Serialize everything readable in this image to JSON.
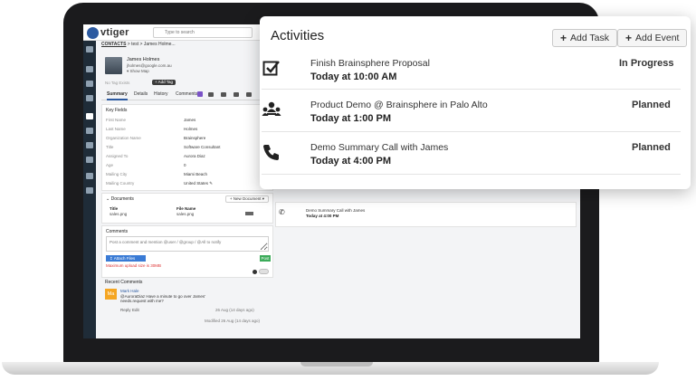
{
  "crm": {
    "logo_text": "vtiger",
    "search_placeholder": "Type to search",
    "breadcrumb": {
      "module": "CONTACTS",
      "rest": " > test > James Holme..."
    },
    "profile": {
      "name": "James Holmes",
      "email": "jholmes@google.com.au",
      "map": "▾ Show Map",
      "tags_empty": "No Tag Exists",
      "add_tag": "+ Add Tag"
    },
    "tabs": {
      "summary": "Summary",
      "details": "Details",
      "history": "History",
      "comments": "Comments"
    },
    "key_fields": {
      "title": "Key Fields",
      "rows": [
        {
          "label": "First Name",
          "value": "James"
        },
        {
          "label": "Last Name",
          "value": "Holmes"
        },
        {
          "label": "Organization Name",
          "value": "Brainsphere"
        },
        {
          "label": "Title",
          "value": "Software Consultant"
        },
        {
          "label": "Assigned To",
          "value": "Aurora Diaz"
        },
        {
          "label": "Age",
          "value": "0"
        },
        {
          "label": "Mailing City",
          "value": "Miami Beach"
        },
        {
          "label": "Mailing Country",
          "value": "United States ✎"
        }
      ]
    },
    "documents": {
      "title": "⌄ Documents",
      "new_button": "+ New Document ▾",
      "col_title": "Title",
      "col_file": "File Name",
      "row_title": "sales.png",
      "row_file": "sales.png"
    },
    "comments": {
      "title": "Comments",
      "placeholder": "Post a comment and mention @user / @group / @All to notify",
      "attach": "↥ Attach Files",
      "post": "Post",
      "note": "Maximum upload size is 30MB"
    },
    "recent_comments": {
      "title": "Recent Comments",
      "avatar": "Ma",
      "author": "Mark Hale",
      "text_1": "@AuroraDiaz Have a minute to go over James'",
      "text_2": "needs.request with me?",
      "date": "26 Aug (14 days ago)",
      "reply": "Reply",
      "edit": "Edit",
      "modified": "Modified 26 Aug (14 days ago)"
    },
    "background_activity": {
      "title": "Demo Summary Call with James",
      "time": "Today at 4:00 PM"
    }
  },
  "popup": {
    "title": "Activities",
    "add_task": "Add Task",
    "add_event": "Add Event",
    "activities": [
      {
        "icon": "checkbox-icon",
        "title": "Finish Brainsphere Proposal",
        "time": "Today at 10:00 AM",
        "status": "In Progress"
      },
      {
        "icon": "group-meeting-icon",
        "title": "Product Demo @ Brainsphere in Palo Alto",
        "time": "Today at 1:00 PM",
        "status": "Planned"
      },
      {
        "icon": "phone-icon",
        "title": "Demo Summary Call with James",
        "time": "Today at 4:00 PM",
        "status": "Planned"
      }
    ]
  },
  "colors": {
    "sidebar": "#1f2c38",
    "accent_blue": "#2c5aa0",
    "post_green": "#3cab5a",
    "avatar_orange": "#f5a623",
    "comments_badge": "#7a52c7",
    "warning_red": "#dd3333"
  }
}
